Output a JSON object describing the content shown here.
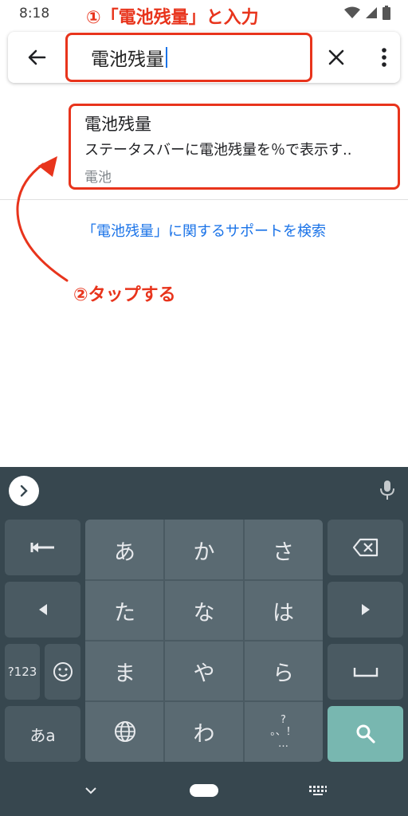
{
  "status": {
    "time": "8:18"
  },
  "search": {
    "query": "電池残量"
  },
  "result": {
    "title": "電池残量",
    "summary": "ステータスバーに電池残量を％で表示す..",
    "category": "電池"
  },
  "support_link": "「電池残量」に関するサポートを検索",
  "annotations": {
    "step1": "①「電池残量」と入力",
    "step2": "②タップする",
    "color": "#e8341c"
  },
  "keyboard": {
    "keys": {
      "a": "あ",
      "ka": "か",
      "sa": "さ",
      "ta": "た",
      "na": "な",
      "ha": "は",
      "ma": "ま",
      "ya": "や",
      "ra": "ら",
      "wa": "わ"
    },
    "num_label": "?123",
    "mode_label": "あa",
    "punct": {
      "q": "?",
      "marks": "。、！",
      "ellipsis": "…"
    }
  },
  "icons": [
    "back-arrow-icon",
    "close-icon",
    "more-vert-icon",
    "chevron-right-icon",
    "mic-icon",
    "undo-icon",
    "backspace-icon",
    "left-arrow-icon",
    "right-arrow-icon",
    "smiley-icon",
    "space-icon",
    "globe-icon",
    "search-icon",
    "nav-back-chevron-icon",
    "nav-home-pill-icon",
    "keyboard-icon",
    "wifi-icon",
    "signal-icon",
    "battery-icon"
  ],
  "colors": {
    "accent": "#1a73e8",
    "keyboard_bg": "#37474f",
    "search_key": "#78b7b0"
  }
}
